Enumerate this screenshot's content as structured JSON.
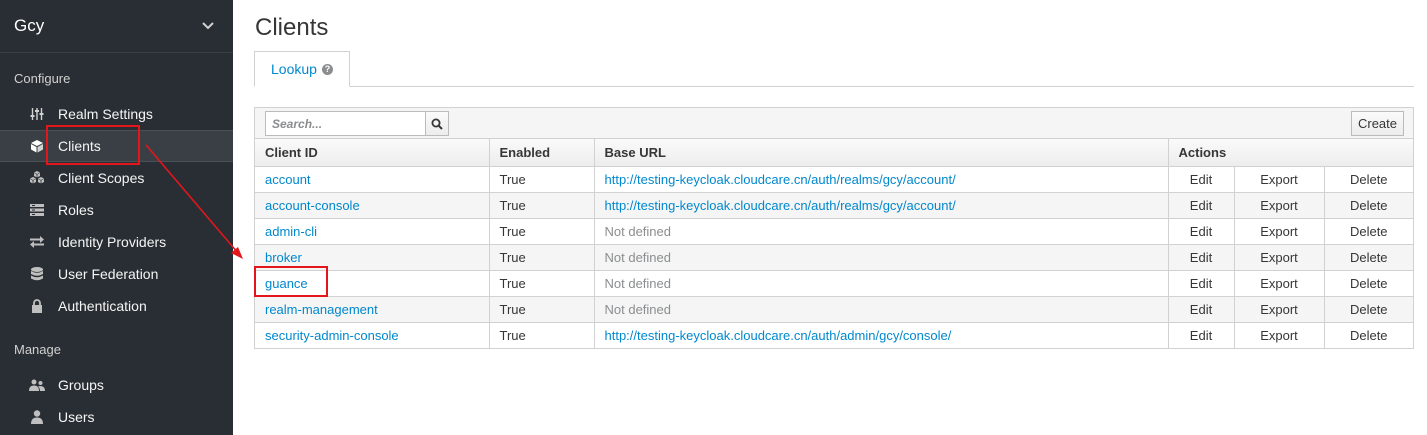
{
  "sidebar": {
    "realm": "Gcy",
    "configure_label": "Configure",
    "manage_label": "Manage",
    "configure_items": [
      {
        "label": "Realm Settings",
        "icon": "sliders-icon"
      },
      {
        "label": "Clients",
        "icon": "cube-icon",
        "active": true
      },
      {
        "label": "Client Scopes",
        "icon": "cubes-icon"
      },
      {
        "label": "Roles",
        "icon": "roles-list-icon"
      },
      {
        "label": "Identity Providers",
        "icon": "exchange-icon"
      },
      {
        "label": "User Federation",
        "icon": "database-icon"
      },
      {
        "label": "Authentication",
        "icon": "lock-icon"
      }
    ],
    "manage_items": [
      {
        "label": "Groups",
        "icon": "users-icon"
      },
      {
        "label": "Users",
        "icon": "user-icon"
      }
    ]
  },
  "main": {
    "title": "Clients",
    "tab_label": "Lookup",
    "search_placeholder": "Search...",
    "create_label": "Create",
    "columns": [
      "Client ID",
      "Enabled",
      "Base URL",
      "Actions"
    ],
    "actions": [
      "Edit",
      "Export",
      "Delete"
    ],
    "rows": [
      {
        "client_id": "account",
        "enabled": "True",
        "base_url": "http://testing-keycloak.cloudcare.cn/auth/realms/gcy/account/",
        "url_defined": true
      },
      {
        "client_id": "account-console",
        "enabled": "True",
        "base_url": "http://testing-keycloak.cloudcare.cn/auth/realms/gcy/account/",
        "url_defined": true
      },
      {
        "client_id": "admin-cli",
        "enabled": "True",
        "base_url": "Not defined",
        "url_defined": false
      },
      {
        "client_id": "broker",
        "enabled": "True",
        "base_url": "Not defined",
        "url_defined": false
      },
      {
        "client_id": "guance",
        "enabled": "True",
        "base_url": "Not defined",
        "url_defined": false
      },
      {
        "client_id": "realm-management",
        "enabled": "True",
        "base_url": "Not defined",
        "url_defined": false
      },
      {
        "client_id": "security-admin-console",
        "enabled": "True",
        "base_url": "http://testing-keycloak.cloudcare.cn/auth/admin/gcy/console/",
        "url_defined": true
      }
    ]
  },
  "colors": {
    "sidebar_bg": "#292e34",
    "link": "#0088ce",
    "annotation": "#e3161c"
  }
}
